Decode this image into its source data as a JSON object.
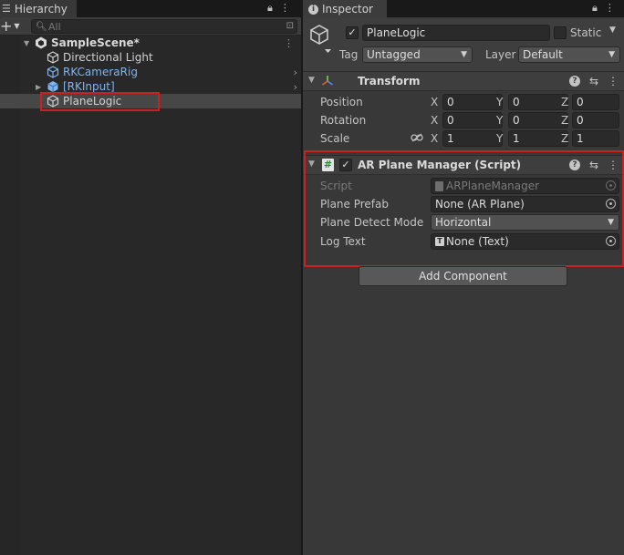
{
  "hierarchy": {
    "tab_title": "Hierarchy",
    "search_placeholder": "All",
    "add_label": "+",
    "items": [
      {
        "label": "SampleScene*"
      },
      {
        "label": "Directional Light"
      },
      {
        "label": "RKCameraRig"
      },
      {
        "label": "[RKInput]"
      },
      {
        "label": "PlaneLogic"
      }
    ]
  },
  "inspector": {
    "tab_title": "Inspector",
    "object": {
      "name": "PlaneLogic",
      "active_check": "✓",
      "static_label": "Static",
      "tag_label": "Tag",
      "tag_value": "Untagged",
      "layer_label": "Layer",
      "layer_value": "Default"
    },
    "transform": {
      "title": "Transform",
      "rows": [
        {
          "label": "Position",
          "x": "0",
          "y": "0",
          "z": "0"
        },
        {
          "label": "Rotation",
          "x": "0",
          "y": "0",
          "z": "0"
        },
        {
          "label": "Scale",
          "x": "1",
          "y": "1",
          "z": "1"
        }
      ],
      "axes": {
        "x": "X",
        "y": "Y",
        "z": "Z"
      }
    },
    "ar_plane_manager": {
      "title": "AR Plane Manager (Script)",
      "enabled_check": "✓",
      "script_label": "Script",
      "script_value": "ARPlaneManager",
      "plane_prefab_label": "Plane Prefab",
      "plane_prefab_value": "None (AR Plane)",
      "detect_mode_label": "Plane Detect Mode",
      "detect_mode_value": "Horizontal",
      "log_text_label": "Log Text",
      "log_text_value": "None (Text)"
    },
    "add_component_label": "Add Component"
  },
  "colors": {
    "selection_outline": "#cc1f1f",
    "prefab_text": "#7fb4ef"
  }
}
